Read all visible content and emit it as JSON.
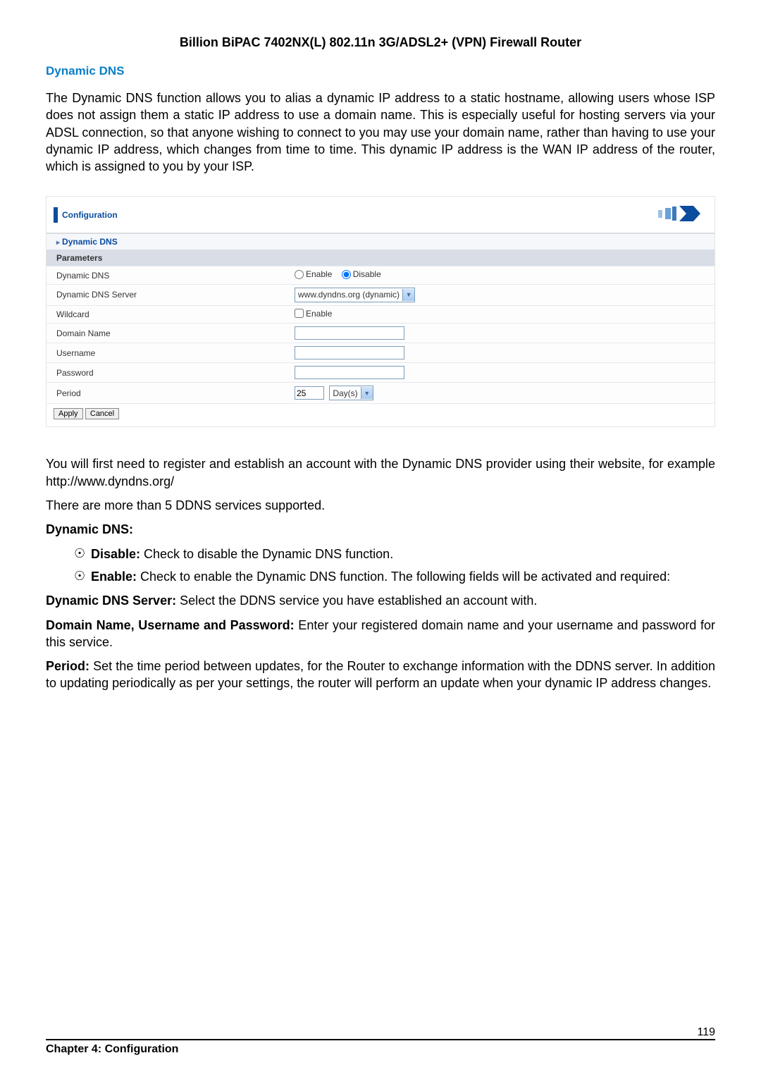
{
  "header": {
    "title": "Billion BiPAC 7402NX(L) 802.11n 3G/ADSL2+ (VPN) Firewall Router"
  },
  "section": {
    "title": "Dynamic DNS",
    "intro": "The Dynamic DNS function allows you to alias a dynamic IP address to a static hostname, allowing users whose ISP does not assign them a static IP address to use a domain name. This is especially useful for hosting servers via your ADSL connection, so that anyone wishing to connect to you may use your domain name, rather than having to use your dynamic IP address, which changes from time to time. This dynamic IP address is the WAN IP address of the router, which is assigned to you by your ISP."
  },
  "panel": {
    "configuration_label": "Configuration",
    "subheader": "Dynamic DNS",
    "parameters_label": "Parameters",
    "rows": {
      "dynamic_dns_label": "Dynamic DNS",
      "enable_label": "Enable",
      "disable_label": "Disable",
      "server_label": "Dynamic DNS Server",
      "server_value": "www.dyndns.org (dynamic)",
      "wildcard_label": "Wildcard",
      "wildcard_check_label": "Enable",
      "domain_label": "Domain Name",
      "username_label": "Username",
      "password_label": "Password",
      "period_label": "Period",
      "period_value": "25",
      "period_unit": "Day(s)"
    },
    "buttons": {
      "apply": "Apply",
      "cancel": "Cancel"
    }
  },
  "below": {
    "p1": "You will first need to register and establish an account with the Dynamic DNS provider using their website, for example http://www.dyndns.org/",
    "p2": "There are more than 5 DDNS services supported.",
    "ddns_title": "Dynamic DNS:",
    "disable_bold": "Disable:",
    "disable_rest": " Check to disable the Dynamic DNS function.",
    "enable_bold": "Enable:",
    "enable_rest": " Check to enable the Dynamic DNS function. The following fields will be activated and required:",
    "server_bold": "Dynamic DNS Server:",
    "server_rest": " Select the DDNS service you have established an account with.",
    "domain_bold": "Domain Name, Username and Password:",
    "domain_rest": " Enter your registered domain name and your username and password for this service.",
    "period_bold": "Period:",
    "period_rest": " Set the time period between updates, for the Router to exchange information with the DDNS server. In addition to updating periodically as per your settings, the router will perform an update when your dynamic IP address changes."
  },
  "footer": {
    "chapter": "Chapter 4: Configuration",
    "page": "119"
  }
}
